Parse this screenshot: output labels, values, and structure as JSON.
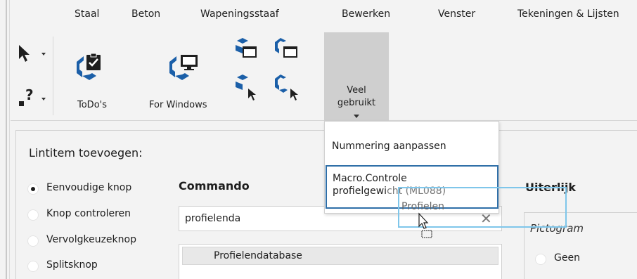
{
  "tabs": [
    {
      "label": "Staal"
    },
    {
      "label": "Beton"
    },
    {
      "label": "Wapeningsstaaf"
    },
    {
      "label": "Bewerken"
    },
    {
      "label": "Venster"
    },
    {
      "label": "Tekeningen & Lijsten"
    }
  ],
  "ribbon": {
    "pointer_tool": {
      "icon": "arrow-pointer-icon"
    },
    "help_tool": {
      "icon": "question-pointer-icon"
    },
    "todos": {
      "label": "ToDo's",
      "icon": "todo-clipboard-icon"
    },
    "for_windows": {
      "label": "For Windows",
      "icon": "monitor-icon"
    },
    "small_icons": [
      "window-icon",
      "window-icon",
      "window-arrow-icon",
      "window-arrow-icon"
    ],
    "veel_gebruikt": {
      "label_line1": "Veel",
      "label_line2": "gebruikt",
      "icon": "chevron-down-icon"
    }
  },
  "dropdown": {
    "items": [
      "Nummering aanpassen"
    ],
    "selected": {
      "line1": "Macro.Controle",
      "line2_prefix": "profielgewi",
      "line2_middle": "cht",
      "line2_suffix": " (ML088)"
    }
  },
  "drag": {
    "label": "Profielen"
  },
  "panel": {
    "title": "Lintitem toevoegen:",
    "options": [
      {
        "label": "Eenvoudige knop",
        "selected": true
      },
      {
        "label": "Knop controleren",
        "selected": false
      },
      {
        "label": "Vervolgkeuzeknop",
        "selected": false
      },
      {
        "label": "Splitsknop",
        "selected": false
      }
    ],
    "commando": {
      "heading": "Commando",
      "search_value": "profielenda",
      "clear_icon": "close-icon",
      "results": [
        "Profielendatabase"
      ]
    },
    "uiterlijk": {
      "heading": "Uiterlijk",
      "pictogram_label": "Pictogram",
      "geen_label": "Geen"
    }
  },
  "colors": {
    "accent_blue": "#2f6fa8",
    "drag_outline": "#7fc6ea",
    "icon_blue": "#1b5fa8",
    "background": "#f3f3f3"
  }
}
